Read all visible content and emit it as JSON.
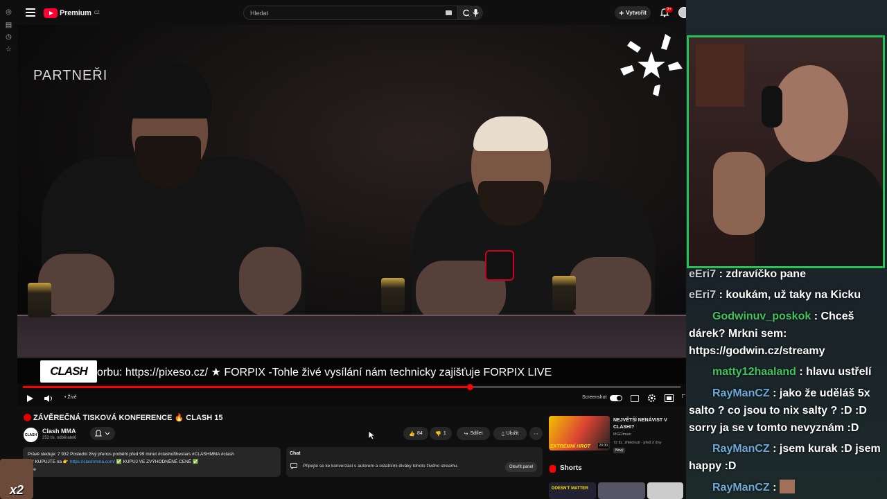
{
  "header": {
    "logo_text": "Premium",
    "logo_region": "CZ",
    "search_placeholder": "Hledat",
    "create_label": "Vytvořit",
    "notifications_badge": "9+"
  },
  "video": {
    "overlay_partners": "PARTNEŘI",
    "ticker_logo": "CLASH",
    "ticker_text": "orbu: https://pixeso.cz/       ★       FORPIX -Tohle živé vysílání nám technicky zajišťuje FORPIX LIVE",
    "live_label": "• Živě",
    "screenshot_label": "Screenshot",
    "progress_fraction": 0.68
  },
  "meta": {
    "title": "ZÁVĚREČNÁ TISKOVÁ KONFERENCE 🔥 CLASH 15",
    "channel_name": "Clash MMA",
    "channel_logo": "CLASH",
    "subscribers": "252 tis. odběratelů",
    "likes": "84",
    "dislikes": "1",
    "share_label": "Sdílet",
    "save_label": "Uložit",
    "description_line1": "Právě sleduje: 7 932  Poslední živý přenos proběhl před 99 minut  #clashofthestars #CLASHMMA #clash",
    "description_line2_prefix": "PV KUPUJTE na 👉 ",
    "description_link": "https://clashmma.com/",
    "description_line2_suffix": " ✅ KUPUJ VE ZVÝHODNĚNÉ CENĚ ✅",
    "description_more": "více"
  },
  "chat_panel": {
    "title": "Chat",
    "message": "Připojte se ke konverzaci s autorem a ostatními diváky tohoto živého streamu.",
    "open_button": "Otevřít panel"
  },
  "recommendation": {
    "thumb_label": "EXTRÉMNÍ HROT",
    "duration": "20:30",
    "title": "NEJVĚTŠÍ NENÁVIST V CLASHI?",
    "channel": "MGFitman",
    "meta": "72 tis. zhlédnutí · před 2 dny",
    "badge": "Nový"
  },
  "shorts": {
    "label": "Shorts",
    "first_thumb_text": "DOESN'T MATTER"
  },
  "stream_chat": [
    {
      "user": "eEri7",
      "text": "zdravíčko pane",
      "style": "grey"
    },
    {
      "user": "eEri7",
      "text": "koukám, už taky na Kicku",
      "style": "grey"
    },
    {
      "user": "Godwinuv_poskok",
      "text": "Chceš dárek? Mrkni sem: https://godwin.cz/streamy",
      "style": "green"
    },
    {
      "user": "matty12haaland",
      "text": "hlavu ustřelí",
      "style": "green"
    },
    {
      "user": "RayManCZ",
      "text": "jako že uděláš 5x salto ? co jsou to nix salty ? :D :D sorry ja se v tomto nevyznám :D",
      "style": "blue"
    },
    {
      "user": "RayManCZ",
      "text": "jsem kurak :D jsem happy :D",
      "style": "blue"
    },
    {
      "user": "RayManCZ",
      "text": "",
      "style": "blue"
    }
  ],
  "emote_overlay": {
    "multiplier": "x2"
  },
  "colors": {
    "accent": "#ff0033",
    "cam_border": "#25c455",
    "link": "#3ea6ff"
  }
}
